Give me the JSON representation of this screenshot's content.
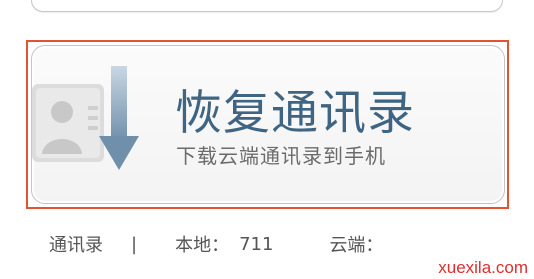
{
  "restore_button": {
    "title": "恢复通讯录",
    "subtitle": "下载云端通讯录到手机",
    "icon": "contact-card-download-icon"
  },
  "status": {
    "contacts_label": "通讯录",
    "separator": "|",
    "local_label": "本地：",
    "local_count": "711",
    "cloud_label": "云端："
  },
  "watermark": "xuexila.com",
  "colors": {
    "highlight_border": "#e25430",
    "title": "#3f6583",
    "watermark": "#e12d2d"
  }
}
